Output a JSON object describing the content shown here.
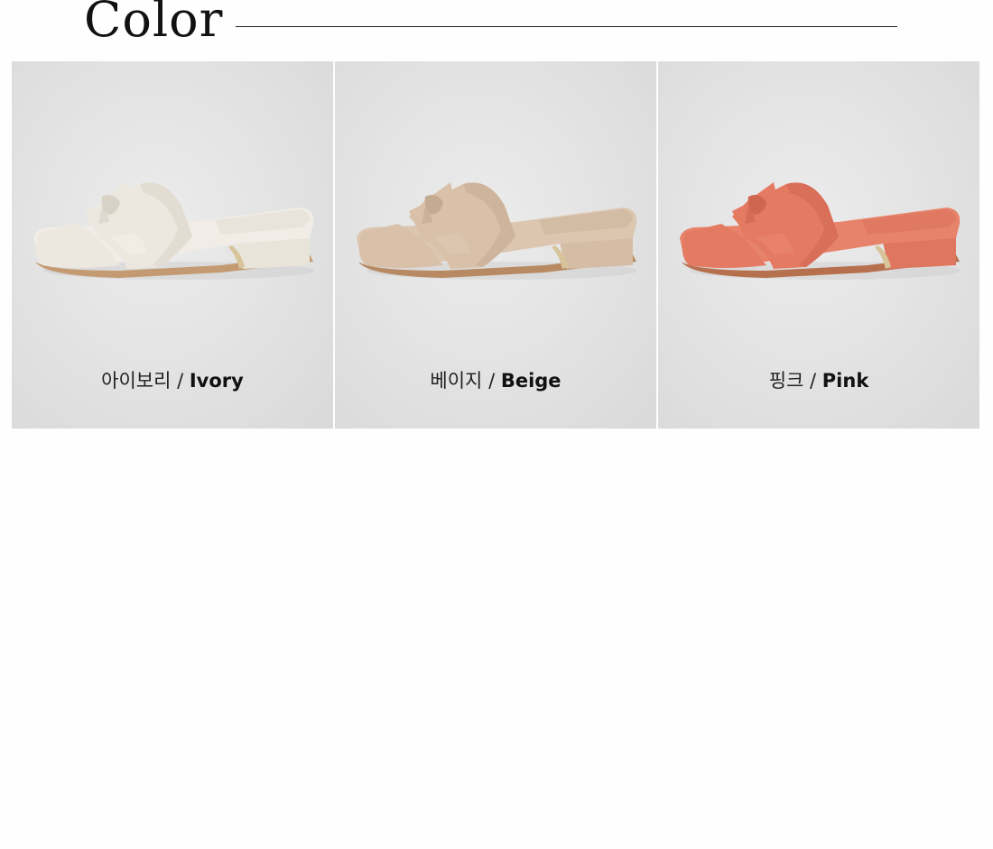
{
  "section": {
    "title": "Color"
  },
  "swatches": [
    {
      "korean": "아이보리",
      "separator": " / ",
      "english": "Ivory",
      "colors": {
        "upper": "#ede8df",
        "upper_shade": "#d8d2c6",
        "insole": "#f1ede6",
        "heel": "#e9e4da",
        "sole": "#c39a72",
        "metal": "#d8c49a"
      }
    },
    {
      "korean": "베이지",
      "separator": " / ",
      "english": "Beige",
      "colors": {
        "upper": "#d9c1a9",
        "upper_shade": "#c4aa90",
        "insole": "#dcc6b0",
        "heel": "#d5bda5",
        "sole": "#b88a63",
        "metal": "#d8c49a"
      }
    },
    {
      "korean": "핑크",
      "separator": " / ",
      "english": "Pink",
      "colors": {
        "upper": "#e57a62",
        "upper_shade": "#cf6650",
        "insole": "#e8836b",
        "heel": "#df7660",
        "sole": "#b7704e",
        "metal": "#d8c49a"
      }
    }
  ]
}
